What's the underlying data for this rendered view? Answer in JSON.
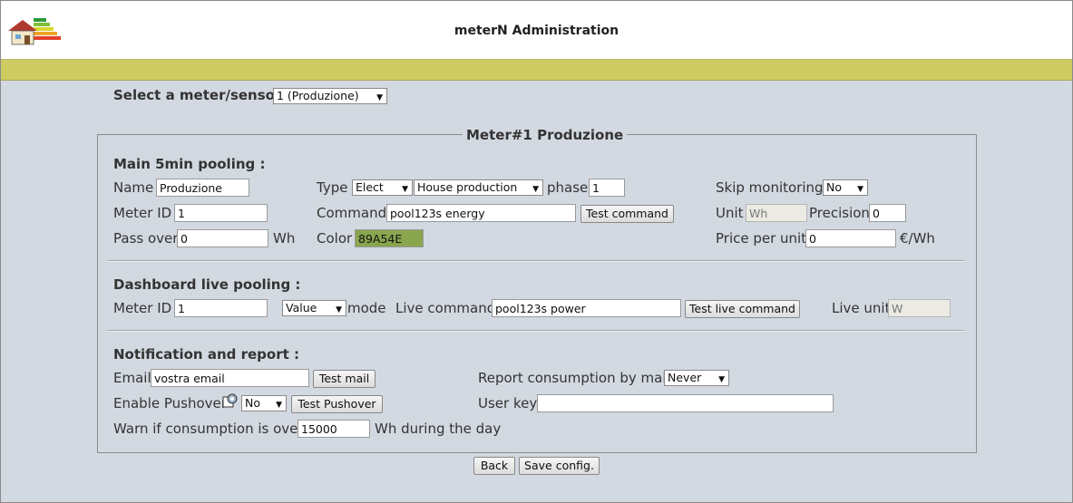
{
  "header": {
    "title": "meterN Administration"
  },
  "select_meter": {
    "label": "Select a meter/sensor :",
    "value": "1 (Produzione)"
  },
  "legend": "Meter#1 Produzione",
  "main": {
    "section_title": "Main 5min pooling :",
    "name_label": "Name",
    "name_value": "Produzione",
    "type_label": "Type",
    "type_value": "Elect",
    "subtype_value": "House production",
    "phase_label": "phase",
    "phase_value": "1",
    "skip_label": "Skip monitoring",
    "skip_value": "No",
    "meterid_label": "Meter ID",
    "meterid_value": "1",
    "command_label": "Command",
    "command_value": "pool123s energy",
    "test_command_label": "Test command",
    "unit_label": "Unit",
    "unit_value": "Wh",
    "precision_label": "Precision",
    "precision_value": "0",
    "passover_label": "Pass over",
    "passover_value": "0",
    "passover_unit": "Wh",
    "color_label": "Color",
    "color_value": "89A54E",
    "color_swatch": "#89A54E",
    "price_label": "Price per unit",
    "price_value": "0",
    "price_unit": "€/Wh"
  },
  "live": {
    "section_title": "Dashboard live pooling :",
    "meterid_label": "Meter ID",
    "meterid_value": "1",
    "mode_value": "Value",
    "mode_label": "mode",
    "command_label": "Live command",
    "command_value": "pool123s power",
    "test_label": "Test live command",
    "unit_label": "Live unit",
    "unit_value": "W"
  },
  "notify": {
    "section_title": "Notification and report :",
    "email_label": "Email",
    "email_value": "vostra email",
    "test_mail_label": "Test mail",
    "report_label": "Report consumption by mail",
    "report_value": "Never",
    "pushover_label": "Enable Pushover",
    "pushover_value": "No",
    "test_pushover_label": "Test Pushover",
    "userkey_label": "User key",
    "userkey_value": "",
    "warn_label": "Warn if consumption is over",
    "warn_value": "15000",
    "warn_suffix": "Wh during the day"
  },
  "footer": {
    "back_label": "Back",
    "save_label": "Save config."
  }
}
